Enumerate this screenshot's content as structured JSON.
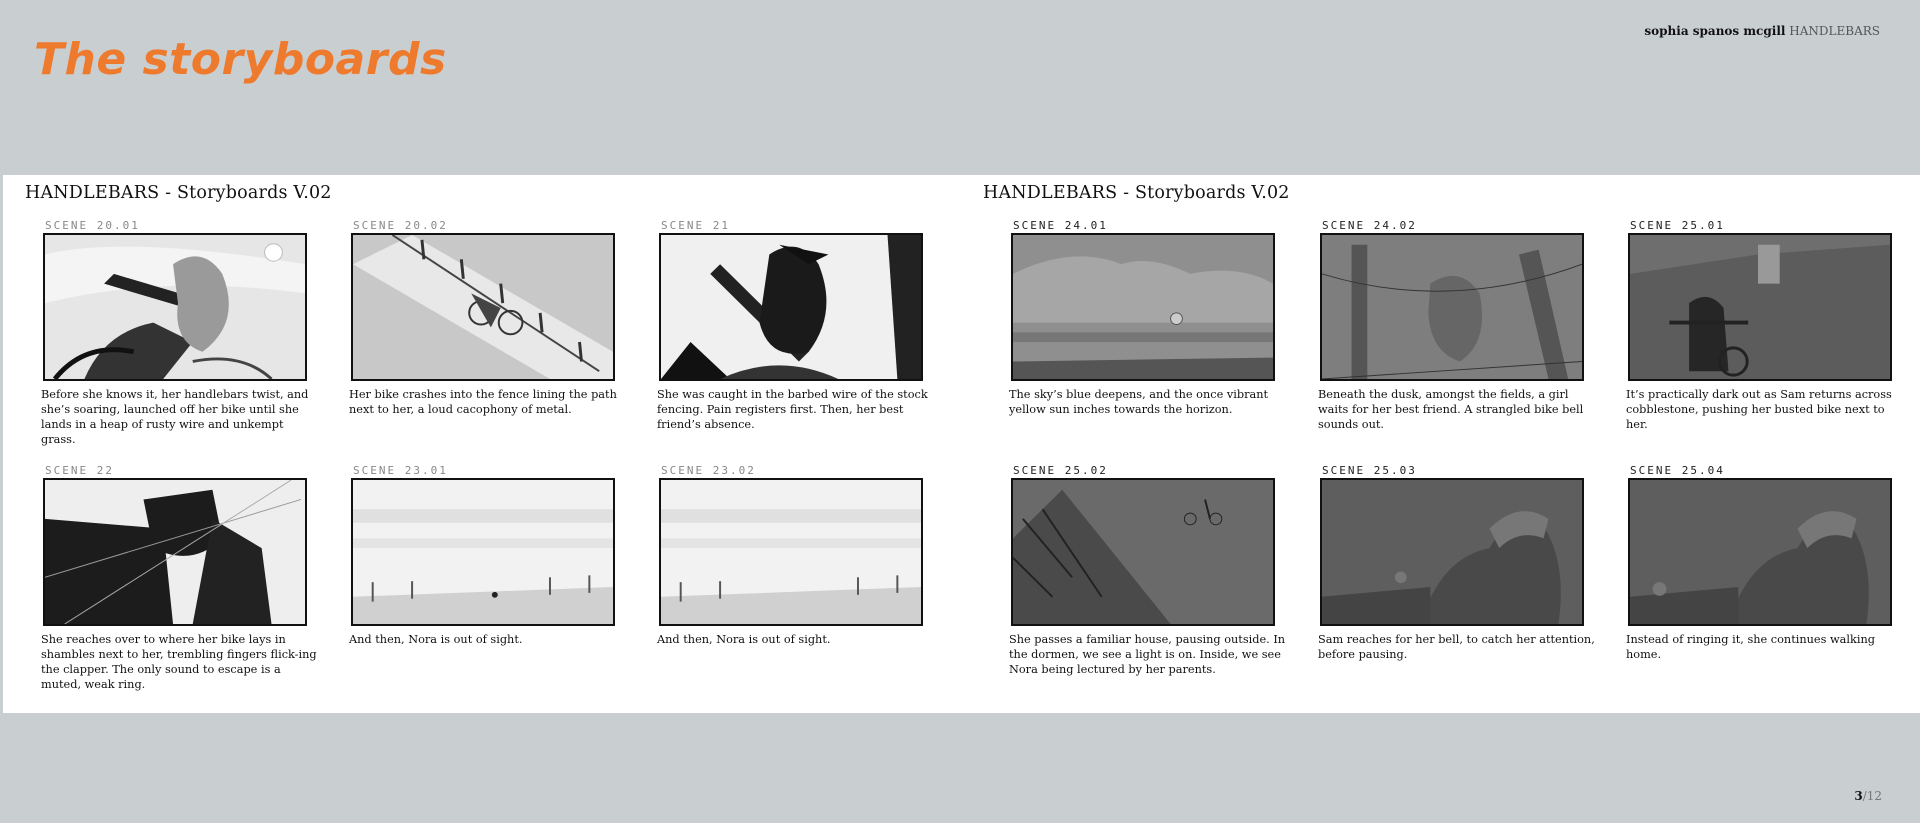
{
  "page": {
    "title": "The storyboards",
    "author": "sophia spanos mcgill",
    "project": "HANDLEBARS",
    "page_current": "3",
    "page_total": "/12",
    "accent_color": "#ee7a2e"
  },
  "boards": [
    {
      "title": "HANDLEBARS - Storyboards V.02",
      "panels": [
        {
          "scene": "SCENE  20.01",
          "caption": "Before she knows it, her handlebars twist, and she’s soaring, launched off her bike until she lands in a heap of rusty wire and unkempt grass."
        },
        {
          "scene": "SCENE  20.02",
          "caption": "Her bike crashes into the fence lining the path next to her, a loud cacophony of metal."
        },
        {
          "scene": "SCENE  21",
          "caption": "She was caught in the barbed wire of the stock fencing. Pain registers first. Then, her best friend’s absence."
        },
        {
          "scene": "SCENE  22",
          "caption": "She reaches over to where her bike lays in shambles next to her, trembling fingers flick-ing the clapper. The only sound to escape is a muted, weak ring."
        },
        {
          "scene": "SCENE  23.01",
          "caption": "And then, Nora is out of sight."
        },
        {
          "scene": "SCENE  23.02",
          "caption": "And then, Nora is out of sight."
        }
      ]
    },
    {
      "title": "HANDLEBARS - Storyboards V.02",
      "panels": [
        {
          "scene": "SCENE  24.01",
          "caption": "The sky’s blue deepens, and the once  vibrant yellow sun inches towards the horizon."
        },
        {
          "scene": "SCENE  24.02",
          "caption": "Beneath the dusk, amongst the fields, a girl waits for her best friend. A strangled bike bell sounds out."
        },
        {
          "scene": "SCENE  25.01",
          "caption": "It’s practically dark out as Sam returns across cobblestone, pushing her busted bike next to her."
        },
        {
          "scene": "SCENE  25.02",
          "caption": "She passes a familiar house, pausing outside. In the dormen, we see a light is on. Inside, we see Nora being lectured by her parents."
        },
        {
          "scene": "SCENE  25.03",
          "caption": "Sam reaches for her bell, to catch her attention, before pausing."
        },
        {
          "scene": "SCENE  25.04",
          "caption": "Instead of ringing it, she continues walking home."
        }
      ]
    }
  ]
}
